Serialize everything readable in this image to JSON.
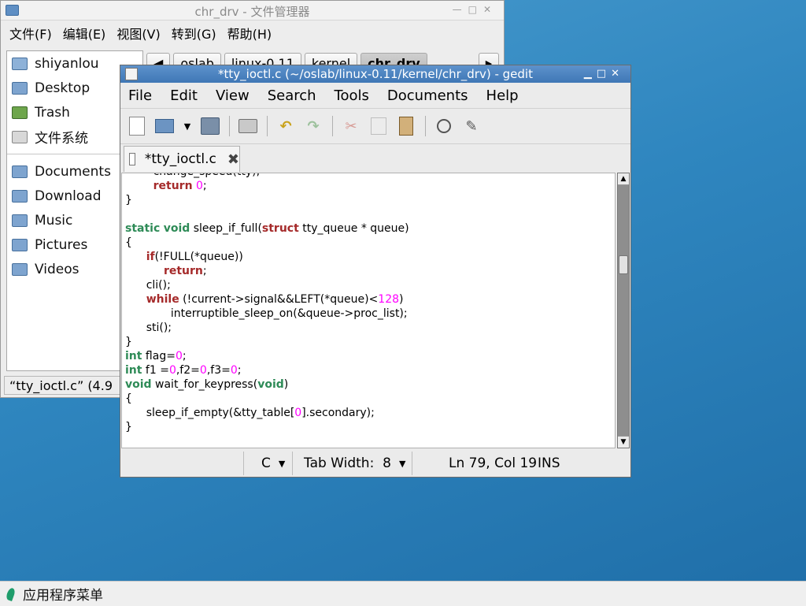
{
  "file_manager": {
    "title": "chr_drv - 文件管理器",
    "menu": [
      "文件(F)",
      "编辑(E)",
      "视图(V)",
      "转到(G)",
      "帮助(H)"
    ],
    "places": [
      "shiyanlou",
      "Desktop",
      "Trash",
      "文件系统"
    ],
    "bookmarks": [
      "Documents",
      "Download",
      "Music",
      "Pictures",
      "Videos"
    ],
    "path": [
      "oslab",
      "linux-0.11",
      "kernel",
      "chr_drv"
    ],
    "status": "“tty_ioctl.c” (4.9"
  },
  "gedit": {
    "title": "*tty_ioctl.c (~/oslab/linux-0.11/kernel/chr_drv) - gedit",
    "menu": [
      "File",
      "Edit",
      "View",
      "Search",
      "Tools",
      "Documents",
      "Help"
    ],
    "tab_label": "*tty_ioctl.c",
    "status": {
      "language": "C",
      "tab_width": "Tab Width:  8",
      "position": "Ln 79, Col 19",
      "mode": "INS"
    }
  },
  "taskbar": {
    "menu_label": "应用程序菜单"
  },
  "colors": {
    "keyword": "#a52a2a",
    "type": "#2e8b57",
    "number": "#ff00ff",
    "gedit_titlebar": "#4a84c2"
  }
}
